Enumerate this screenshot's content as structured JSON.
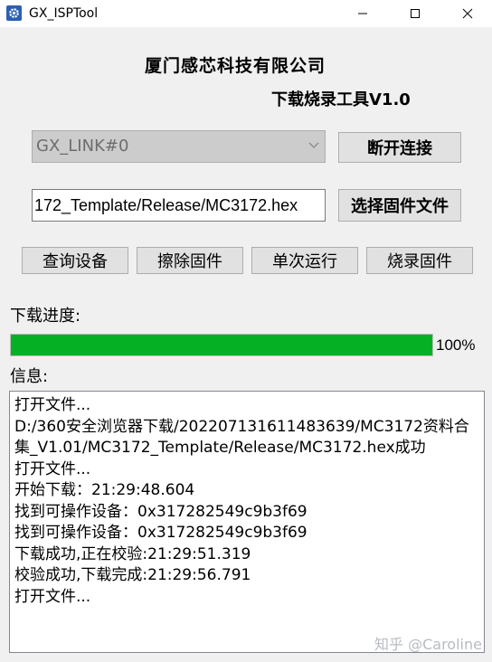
{
  "window": {
    "title": "GX_ISPTool"
  },
  "header": {
    "company": "厦门感芯科技有限公司",
    "subtitle": "下载烧录工具V1.0"
  },
  "device": {
    "selected": "GX_LINK#0",
    "disconnect_label": "断开连接"
  },
  "firmware": {
    "path": "172_Template/Release/MC3172.hex",
    "select_label": "选择固件文件"
  },
  "actions": {
    "query": "查询设备",
    "erase": "擦除固件",
    "single_run": "单次运行",
    "burn": "烧录固件"
  },
  "progress": {
    "label": "下载进度:",
    "value": 100,
    "text": "100%"
  },
  "info": {
    "label": "信息:",
    "lines": [
      "打开文件...",
      "D:/360安全浏览器下载/20220713161148363​9/MC3172资料合集_V1.01/MC3172_Template/Release/MC3172.hex成功",
      "打开文件...",
      "开始下载：21:29:48.604",
      "找到可操作设备：0x317282549c9b3f69",
      "找到可操作设备：0x317282549c9b3f69",
      "下载成功,正在校验:21:29:51.319",
      "校验成功,下载完成:21:29:56.791",
      "打开文件..."
    ]
  },
  "watermark": "知乎 @Caroline",
  "colors": {
    "progress": "#06b025",
    "app_icon": "#2b5fb4"
  }
}
